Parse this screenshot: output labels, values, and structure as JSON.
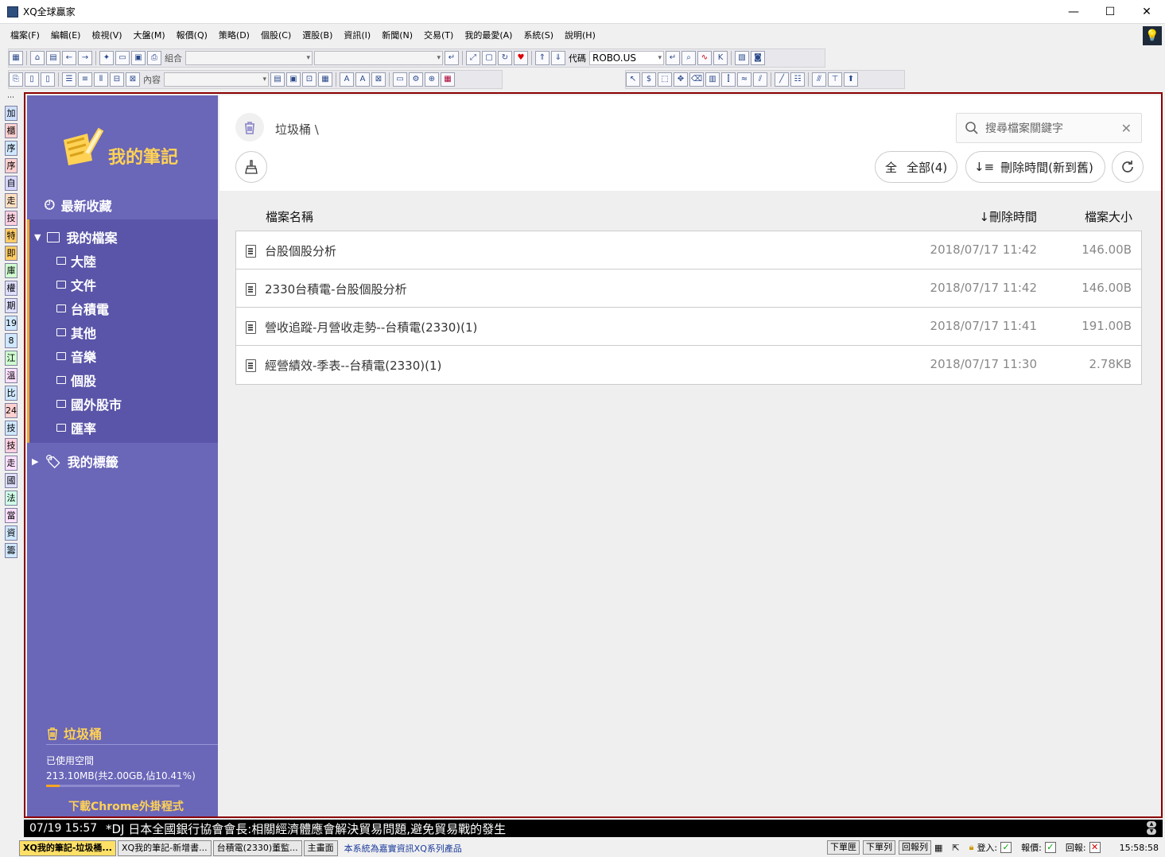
{
  "window": {
    "title": "XQ全球贏家",
    "controls": {
      "minimize": "—",
      "maximize": "☐",
      "close": "✕"
    }
  },
  "menu": [
    "檔案(F)",
    "編輯(E)",
    "檢視(V)",
    "大盤(M)",
    "報價(Q)",
    "策略(D)",
    "個股(C)",
    "選股(B)",
    "資訊(I)",
    "新聞(N)",
    "交易(T)",
    "我的最愛(A)",
    "系統(S)",
    "說明(H)"
  ],
  "toolbar": {
    "group_label": "組合",
    "group_value": "",
    "code_label": "代碼",
    "code_value": "ROBO.US",
    "content_label": "內容",
    "content_value": ""
  },
  "left_strip": [
    "加",
    "櫃",
    "序",
    "序",
    "自",
    "走",
    "技",
    "特",
    "即",
    "庫",
    "權",
    "期",
    "19",
    "8",
    "江",
    "溫",
    "比",
    "24",
    "技",
    "技",
    "走",
    "國",
    "法",
    "當",
    "資",
    "籌"
  ],
  "sidebar": {
    "app_name": "我的筆記",
    "recent": "最新收藏",
    "my_files": "我的檔案",
    "folders": [
      "大陸",
      "文件",
      "台積電",
      "其他",
      "音樂",
      "個股",
      "國外股市",
      "匯率"
    ],
    "my_tags": "我的標籤",
    "trash": "垃圾桶",
    "storage_label": "已使用空間",
    "storage_value": "213.10MB(共2.00GB,佔10.41%)",
    "storage_fraction": 0.1041,
    "chrome_link": "下載Chrome外掛程式"
  },
  "content": {
    "breadcrumb": "垃圾桶 \\",
    "search_placeholder": "搜尋檔案關鍵字",
    "filter_icon": "全",
    "filter_label": "全部(4)",
    "sort_label": "刪除時間(新到舊)",
    "columns": {
      "name": "檔案名稱",
      "time": "↓刪除時間",
      "size": "檔案大小"
    },
    "files": [
      {
        "name": "台股個股分析",
        "time": "2018/07/17 11:42",
        "size": "146.00B"
      },
      {
        "name": "2330台積電-台股個股分析",
        "time": "2018/07/17 11:42",
        "size": "146.00B"
      },
      {
        "name": "營收追蹤-月營收走勢--台積電(2330)(1)",
        "time": "2018/07/17 11:41",
        "size": "191.00B"
      },
      {
        "name": "經營績效-季表--台積電(2330)(1)",
        "time": "2018/07/17 11:30",
        "size": "2.78KB"
      }
    ]
  },
  "ticker": {
    "time": "07/19 15:57",
    "news": "*DJ 日本全國銀行協會會長:相關經濟體應會解決貿易問題,避免貿易戰的發生"
  },
  "statusbar": {
    "tasks": [
      "XQ我的筆記-垃圾桶...",
      "XQ我的筆記-新增書...",
      "台積電(2330)董監...",
      "主畫面"
    ],
    "system_message": "本系統為嘉實資訊XQ系列產品",
    "buttons": [
      "下單匣",
      "下單列",
      "回報列"
    ],
    "login_label": "登入:",
    "quote_label": "報價:",
    "report_label": "回報:",
    "clock": "15:58:58"
  }
}
